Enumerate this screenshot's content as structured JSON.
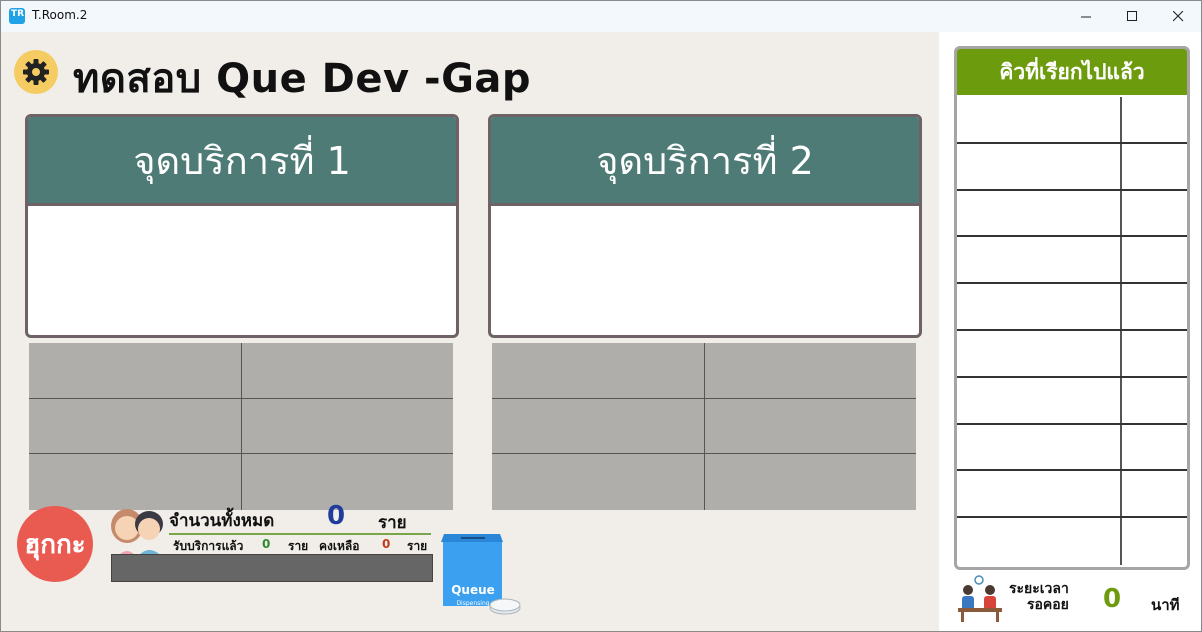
{
  "window": {
    "title": "T.Room.2",
    "icon_text": "TR"
  },
  "page": {
    "title": "ทดสอบ Que Dev -Gap"
  },
  "counters": [
    {
      "label": "จุดบริการที่ 1"
    },
    {
      "label": "จุดบริการที่ 2"
    }
  ],
  "logo": {
    "text": "ฮุกกะ"
  },
  "stats": {
    "total_label": "จำนวนทั้งหมด",
    "total_value": "0",
    "total_unit": "ราย",
    "served_label": "รับบริการแล้ว",
    "served_value": "0",
    "served_unit": "ราย",
    "remaining_label": "คงเหลือ",
    "remaining_value": "0",
    "remaining_unit": "ราย"
  },
  "queue_box": {
    "title": "Queue",
    "subtitle": "Dispensing"
  },
  "called": {
    "title": "คิวที่เรียกไปแล้ว"
  },
  "wait": {
    "label_line1": "ระยะเวลา",
    "label_line2": "รอคอย",
    "value": "0",
    "unit": "นาที"
  },
  "colors": {
    "header": "#4e7b75",
    "called_header": "#6d9b0e",
    "logo": "#e95b50",
    "gear": "#f5cc61",
    "total_value": "#1f3c9c"
  },
  "icons": {
    "settings": "gear-icon",
    "people": "people-icon",
    "queue": "queue-dispenser-icon",
    "waiting": "waiting-people-icon"
  }
}
